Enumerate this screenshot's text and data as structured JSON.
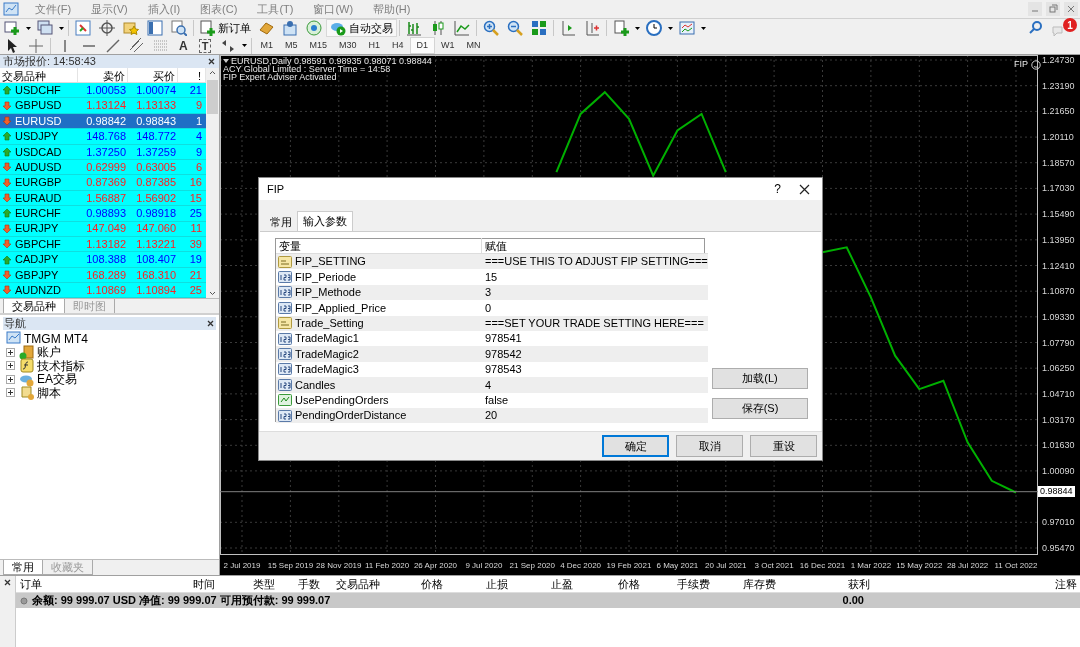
{
  "menu": [
    "文件(F)",
    "显示(V)",
    "插入(I)",
    "图表(C)",
    "工具(T)",
    "窗口(W)",
    "帮助(H)"
  ],
  "toolbar": {
    "new_order": "新订单",
    "auto_trading": "自动交易",
    "text_tool": "A",
    "label_tool": "T",
    "notifications": "1"
  },
  "timeframes": [
    {
      "label": "M1",
      "selected": false
    },
    {
      "label": "M5",
      "selected": false
    },
    {
      "label": "M15",
      "selected": false
    },
    {
      "label": "M30",
      "selected": false
    },
    {
      "label": "H1",
      "selected": false
    },
    {
      "label": "H4",
      "selected": false
    },
    {
      "label": "D1",
      "selected": true
    },
    {
      "label": "W1",
      "selected": false
    },
    {
      "label": "MN",
      "selected": false
    }
  ],
  "market_watch": {
    "title": "市场报价: 14:58:43",
    "columns": [
      "交易品种",
      "卖价",
      "买价",
      "!"
    ],
    "rows": [
      {
        "symbol": "USDCHF",
        "bid": "1.00053",
        "ask": "1.00074",
        "spread": "21",
        "up": true,
        "selected": false
      },
      {
        "symbol": "GBPUSD",
        "bid": "1.13124",
        "ask": "1.13133",
        "spread": "9",
        "up": false,
        "selected": false
      },
      {
        "symbol": "EURUSD",
        "bid": "0.98842",
        "ask": "0.98843",
        "spread": "1",
        "up": false,
        "selected": true
      },
      {
        "symbol": "USDJPY",
        "bid": "148.768",
        "ask": "148.772",
        "spread": "4",
        "up": true,
        "selected": false
      },
      {
        "symbol": "USDCAD",
        "bid": "1.37250",
        "ask": "1.37259",
        "spread": "9",
        "up": true,
        "selected": false
      },
      {
        "symbol": "AUDUSD",
        "bid": "0.62999",
        "ask": "0.63005",
        "spread": "6",
        "up": false,
        "selected": false
      },
      {
        "symbol": "EURGBP",
        "bid": "0.87369",
        "ask": "0.87385",
        "spread": "16",
        "up": false,
        "selected": false
      },
      {
        "symbol": "EURAUD",
        "bid": "1.56887",
        "ask": "1.56902",
        "spread": "15",
        "up": false,
        "selected": false
      },
      {
        "symbol": "EURCHF",
        "bid": "0.98893",
        "ask": "0.98918",
        "spread": "25",
        "up": true,
        "selected": false
      },
      {
        "symbol": "EURJPY",
        "bid": "147.049",
        "ask": "147.060",
        "spread": "11",
        "up": false,
        "selected": false
      },
      {
        "symbol": "GBPCHF",
        "bid": "1.13182",
        "ask": "1.13221",
        "spread": "39",
        "up": false,
        "selected": false
      },
      {
        "symbol": "CADJPY",
        "bid": "108.388",
        "ask": "108.407",
        "spread": "19",
        "up": true,
        "selected": false
      },
      {
        "symbol": "GBPJPY",
        "bid": "168.289",
        "ask": "168.310",
        "spread": "21",
        "up": false,
        "selected": false
      },
      {
        "symbol": "AUDNZD",
        "bid": "1.10869",
        "ask": "1.10894",
        "spread": "25",
        "up": false,
        "selected": false
      }
    ],
    "tabs": [
      {
        "label": "交易品种",
        "selected": true
      },
      {
        "label": "即时图",
        "selected": false
      }
    ]
  },
  "navigator": {
    "title": "导航",
    "tree": [
      {
        "label": "TMGM MT4",
        "kind": "root",
        "children": [
          {
            "label": "账户",
            "kind": "accounts",
            "expanded": false
          },
          {
            "label": "技术指标",
            "kind": "indicators",
            "expanded": false
          },
          {
            "label": "EA交易",
            "kind": "experts",
            "expanded": false
          },
          {
            "label": "脚本",
            "kind": "scripts",
            "expanded": false
          }
        ]
      }
    ],
    "tabs": [
      {
        "label": "常用",
        "selected": true
      },
      {
        "label": "收藏夹",
        "selected": false
      }
    ]
  },
  "chart": {
    "header": [
      "EURUSD,Daily  0.98591 0.98935 0.98071 0.98844",
      "ACY Global Limited : Server Time = 14:58",
      "FIP Expert Adviser Activated"
    ],
    "ea_name": "FIP",
    "chart_data": {
      "type": "line",
      "grid": true,
      "categories": [
        "2 Jul 2019",
        null,
        "15 Sep 2019",
        null,
        "28 Nov 2019",
        null,
        "11 Feb 2020",
        null,
        "26 Apr 2020",
        null,
        "9 Jul 2020",
        null,
        "21 Sep 2020",
        null,
        "4 Dec 2020",
        null,
        "19 Feb 2021",
        null,
        "6 May 2021",
        null,
        "20 Jul 2021",
        null,
        "3 Oct 2021",
        null,
        "16 Dec 2021",
        null,
        "1 Mar 2022",
        null,
        "15 May 2022",
        null,
        "28 Jul 2022",
        null,
        "11 Oct 2022"
      ],
      "ref_lines": [
        {
          "axis": "y",
          "value": 0.98844,
          "label": "0.98844"
        }
      ],
      "series": [
        {
          "color": "#00b000",
          "values": [
            null,
            null,
            null,
            null,
            null,
            null,
            null,
            null,
            null,
            null,
            null,
            null,
            null,
            1.18,
            1.215,
            1.228,
            1.212,
            1.178,
            1.205,
            1.215,
            1.18,
            null,
            null,
            null,
            1.132,
            1.135,
            1.105,
            1.07,
            1.05,
            1.055,
            1.018,
            0.995,
            0.988
          ]
        }
      ],
      "ylim": [
        0.9547,
        1.2473
      ],
      "yticks": [
        {
          "value": 1.2473,
          "label": "1.24730"
        },
        {
          "value": 1.2319,
          "label": "1.23190"
        },
        {
          "value": 1.2165,
          "label": "1.21650"
        },
        {
          "value": 1.2011,
          "label": "1.20110"
        },
        {
          "value": 1.1857,
          "label": "1.18570"
        },
        {
          "value": 1.1703,
          "label": "1.17030"
        },
        {
          "value": 1.1549,
          "label": "1.15490"
        },
        {
          "value": 1.1395,
          "label": "1.13950"
        },
        {
          "value": 1.1241,
          "label": "1.12410"
        },
        {
          "value": 1.1087,
          "label": "1.10870"
        },
        {
          "value": 1.0933,
          "label": "1.09330"
        },
        {
          "value": 1.0779,
          "label": "1.07790"
        },
        {
          "value": 1.0625,
          "label": "1.06250"
        },
        {
          "value": 1.0471,
          "label": "1.04710"
        },
        {
          "value": 1.0317,
          "label": "1.03170"
        },
        {
          "value": 1.0163,
          "label": "1.01630"
        },
        {
          "value": 1.0009,
          "label": "1.00090"
        },
        {
          "value": 0.9701,
          "label": "0.97010"
        },
        {
          "value": 0.9547,
          "label": "0.95470"
        }
      ]
    }
  },
  "dialog": {
    "title": "FIP",
    "help": "?",
    "tabs": [
      {
        "label": "常用",
        "selected": false
      },
      {
        "label": "输入参数",
        "selected": true
      }
    ],
    "columns": [
      "变量",
      "赋值"
    ],
    "params": [
      {
        "name": "FIP_SETTING",
        "value": "===USE THIS TO ADJUST FIP SETTING===",
        "kind": "string"
      },
      {
        "name": "FIP_Periode",
        "value": "15",
        "kind": "number"
      },
      {
        "name": "FIP_Methode",
        "value": "3",
        "kind": "number"
      },
      {
        "name": "FIP_Applied_Price",
        "value": "0",
        "kind": "number"
      },
      {
        "name": "Trade_Setting",
        "value": "===SET YOUR TRADE SETTING HERE===",
        "kind": "string"
      },
      {
        "name": "TradeMagic1",
        "value": "978541",
        "kind": "number"
      },
      {
        "name": "TradeMagic2",
        "value": "978542",
        "kind": "number"
      },
      {
        "name": "TradeMagic3",
        "value": "978543",
        "kind": "number"
      },
      {
        "name": "Candles",
        "value": "4",
        "kind": "number"
      },
      {
        "name": "UsePendingOrders",
        "value": "false",
        "kind": "bool"
      },
      {
        "name": "PendingOrderDistance",
        "value": "20",
        "kind": "number"
      }
    ],
    "side_buttons": [
      "加载(L)",
      "保存(S)"
    ],
    "buttons": [
      "确定",
      "取消",
      "重设"
    ]
  },
  "terminal": {
    "columns": [
      "订单",
      "时间",
      "类型",
      "手数",
      "交易品种",
      "价格",
      "止损",
      "止盈",
      "价格",
      "手续费",
      "库存费",
      "获利",
      "注释"
    ],
    "balance": "余额: 99 999.07 USD  净值: 99 999.07  可用预付款: 99 999.07",
    "profit": "0.00"
  }
}
